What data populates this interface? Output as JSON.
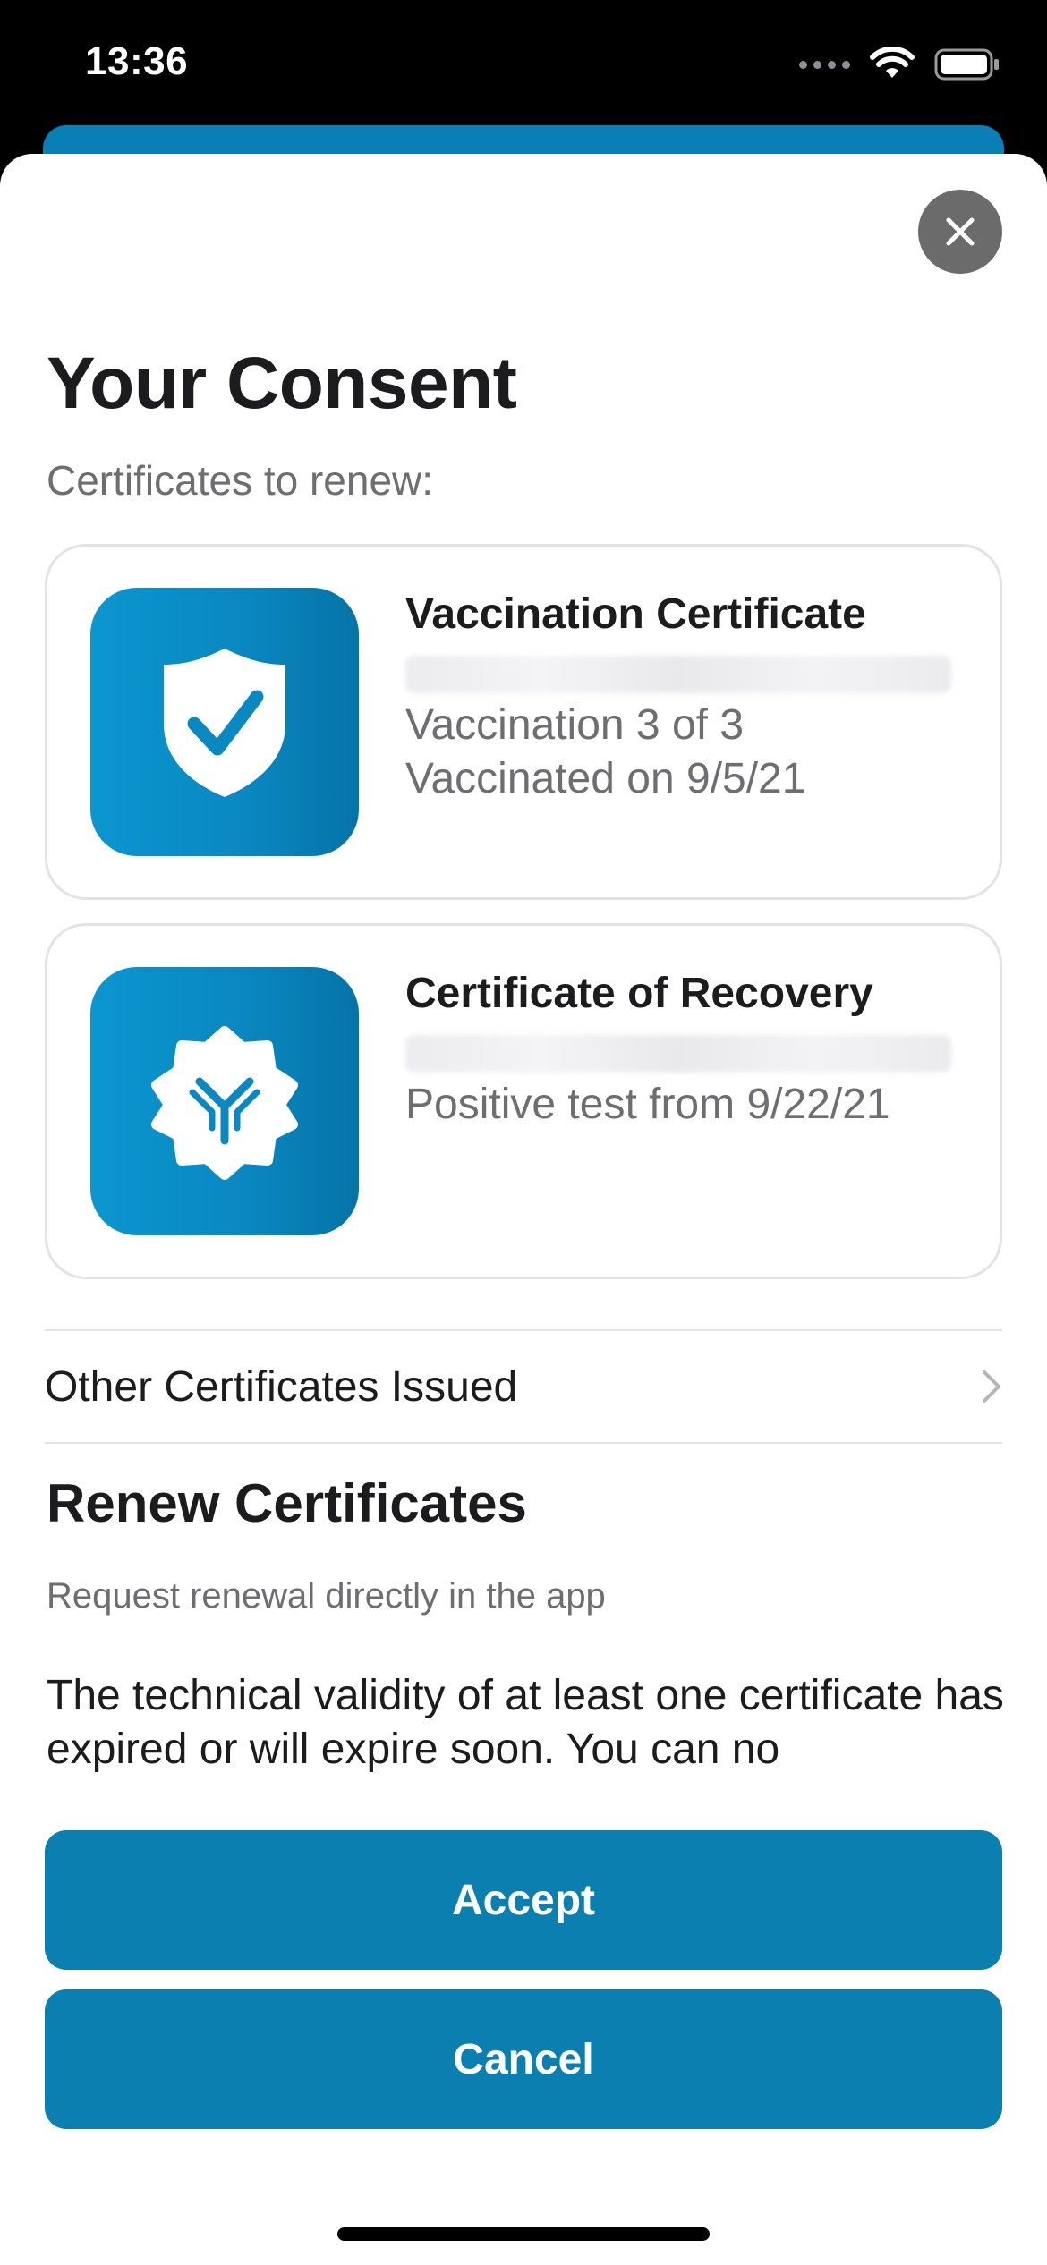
{
  "status_bar": {
    "time": "13:36"
  },
  "sheet": {
    "title": "Your Consent",
    "subtitle": "Certificates to renew:",
    "certificates": [
      {
        "icon": "shield-check-icon",
        "title": "Vaccination Certificate",
        "lines": [
          "Vaccination 3 of 3",
          "Vaccinated on 9/5/21"
        ]
      },
      {
        "icon": "antibody-icon",
        "title": "Certificate of Recovery",
        "lines": [
          "Positive test from 9/22/21"
        ]
      }
    ],
    "other_certificates_label": "Other Certificates Issued",
    "renew": {
      "title": "Renew Certificates",
      "subtitle": "Request renewal directly in the app",
      "body": "The technical validity of at least one certificate has expired or will expire soon. You can no"
    },
    "buttons": {
      "accept": "Accept",
      "cancel": "Cancel"
    }
  },
  "colors": {
    "accent": "#0a7fb0",
    "icon_gradient_start": "#0b96cf",
    "icon_gradient_end": "#0574a8",
    "text_primary": "#1c1c1e",
    "text_secondary": "#6d6d72",
    "close_button": "#6b6b6b"
  }
}
